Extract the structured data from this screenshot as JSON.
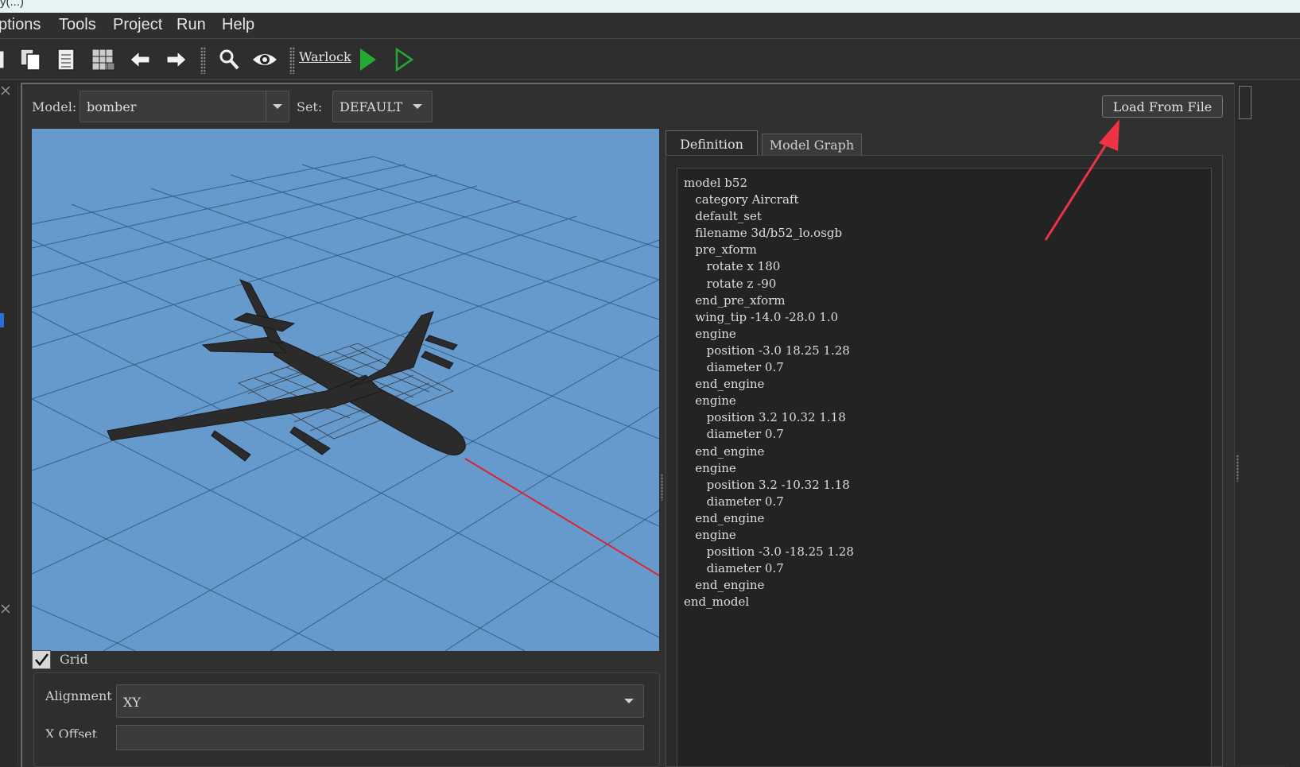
{
  "window": {
    "title_fragment": "y(...)"
  },
  "menubar": {
    "items": [
      "ptions",
      "Tools",
      "Project",
      "Run",
      "Help"
    ]
  },
  "toolbar": {
    "warlock_label": "Warlock"
  },
  "model_selector": {
    "label": "Model:",
    "value": "bomber"
  },
  "set_selector": {
    "label": "Set:",
    "value": "DEFAULT"
  },
  "load_button": {
    "label": "Load From File"
  },
  "tabs": {
    "definition": "Definition",
    "model_graph": "Model Graph"
  },
  "definition_lines": [
    "model b52",
    "   category Aircraft",
    "   default_set",
    "   filename 3d/b52_lo.osgb",
    "   pre_xform",
    "      rotate x 180",
    "      rotate z -90",
    "   end_pre_xform",
    "   wing_tip -14.0 -28.0 1.0",
    "   engine",
    "      position -3.0 18.25 1.28",
    "      diameter 0.7",
    "   end_engine",
    "   engine",
    "      position 3.2 10.32 1.18",
    "      diameter 0.7",
    "   end_engine",
    "   engine",
    "      position 3.2 -10.32 1.18",
    "      diameter 0.7",
    "   end_engine",
    "   engine",
    "      position -3.0 -18.25 1.28",
    "      diameter 0.7",
    "   end_engine",
    "end_model"
  ],
  "grid": {
    "checkbox_label": "Grid",
    "checked": true,
    "alignment_label": "Alignment",
    "alignment_value": "XY",
    "offset_label": "X Offset"
  },
  "colors": {
    "viewport_bg": "#6699cc",
    "accent_green": "#22aa33",
    "annotation_arrow": "#ee3344",
    "axis_line": "#dd2233"
  }
}
